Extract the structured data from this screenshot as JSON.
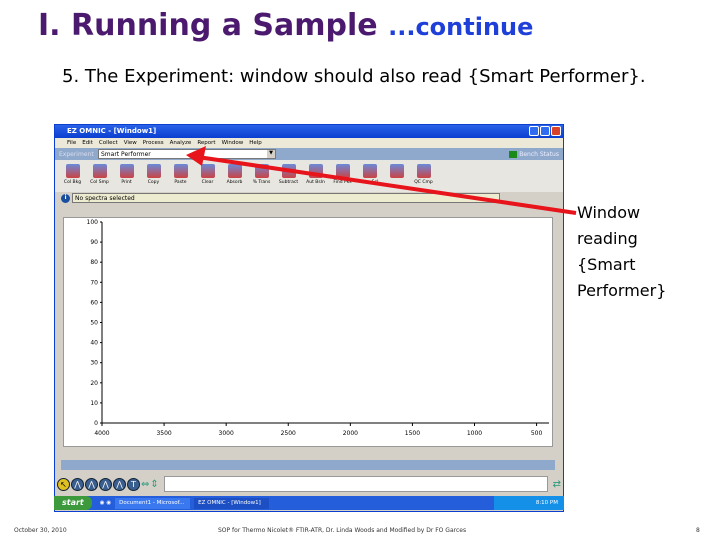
{
  "slide": {
    "title": "I.  Running a Sample",
    "title_cont": "...continue",
    "subtitle": "5. The Experiment: window should also read {Smart Performer}.",
    "callout": [
      "Window",
      "reading",
      "{Smart",
      "Performer}"
    ],
    "footer": {
      "date": "October 30, 2010",
      "center": "SOP for Thermo Nicolet® FTIR-ATR,  Dr. Linda Woods and Modified by Dr FO Garces",
      "page": "8"
    }
  },
  "window": {
    "title": "EZ OMNIC - [Window1]",
    "menu": [
      "File",
      "Edit",
      "Collect",
      "View",
      "Process",
      "Analyze",
      "Report",
      "Window",
      "Help"
    ],
    "experiment_label": "Experiment",
    "experiment_value": "Smart Performer",
    "bench_status": "Bench Status",
    "toolbar": [
      "Col Bkg",
      "Col Smp",
      "Print",
      "Copy",
      "Paste",
      "Clear",
      "Absorb",
      "% Trans",
      "Subtract",
      "Aut Bsln",
      "Find Pks",
      "Nrm Scl",
      "",
      "QC Cmp"
    ],
    "info": "No spectra selected",
    "plot": {
      "y_ticks": [
        "100",
        "90",
        "80",
        "70",
        "60",
        "50",
        "40",
        "30",
        "20",
        "10",
        "0"
      ],
      "x_ticks": [
        "4000",
        "3500",
        "3000",
        "2500",
        "2000",
        "1500",
        "1000",
        "500"
      ]
    },
    "bottom_tools": [
      "pointer",
      "region",
      "peak-height",
      "peak-area",
      "label",
      "T",
      "expand-x",
      "expand-y"
    ]
  },
  "taskbar": {
    "start": "start",
    "tasks": [
      "Document1 - Microsof...",
      "EZ OMNIC - [Window1]"
    ],
    "time": "8:10 PM"
  },
  "colors": {
    "title": "#4b1a6e",
    "continue": "#1f3fd9",
    "arrow": "#e8141b"
  }
}
